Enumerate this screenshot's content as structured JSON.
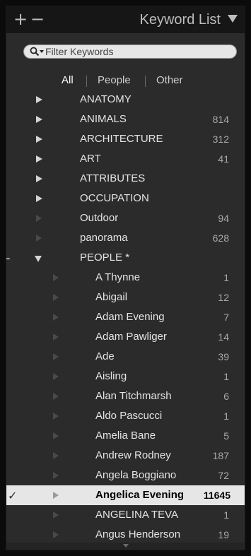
{
  "header": {
    "add_label": "+",
    "remove_label": "−",
    "title": "Keyword List"
  },
  "search": {
    "placeholder": "Filter Keywords"
  },
  "filter_tabs": [
    {
      "label": "All",
      "active": true
    },
    {
      "label": "People",
      "active": false
    },
    {
      "label": "Other",
      "active": false
    }
  ],
  "keywords": [
    {
      "label": "ANATOMY",
      "count": ""
    },
    {
      "label": "ANIMALS",
      "count": "814"
    },
    {
      "label": "ARCHITECTURE",
      "count": "312"
    },
    {
      "label": "ART",
      "count": "41"
    },
    {
      "label": "ATTRIBUTES",
      "count": ""
    },
    {
      "label": "OCCUPATION",
      "count": ""
    },
    {
      "label": "Outdoor",
      "count": "94"
    },
    {
      "label": "panorama",
      "count": "628"
    },
    {
      "label": "PEOPLE  *",
      "count": ""
    },
    {
      "label": "A Thynne",
      "count": "1"
    },
    {
      "label": "Abigail",
      "count": "12"
    },
    {
      "label": "Adam Evening",
      "count": "7"
    },
    {
      "label": "Adam Pawliger",
      "count": "14"
    },
    {
      "label": "Ade",
      "count": "39"
    },
    {
      "label": "Aisling",
      "count": "1"
    },
    {
      "label": "Alan Titchmarsh",
      "count": "6"
    },
    {
      "label": "Aldo Pascucci",
      "count": "1"
    },
    {
      "label": "Amelia Bane",
      "count": "5"
    },
    {
      "label": "Andrew Rodney",
      "count": "187"
    },
    {
      "label": "Angela Boggiano",
      "count": "72"
    },
    {
      "label": "Angelica Evening",
      "count": "11645"
    },
    {
      "label": "ANGELINA TEVA",
      "count": "1"
    },
    {
      "label": "Angus Henderson",
      "count": "19"
    }
  ],
  "colors": {
    "panel_bg": "#2b2b2b",
    "header_bg": "#161616",
    "selected_bg": "#e6e6e6"
  }
}
